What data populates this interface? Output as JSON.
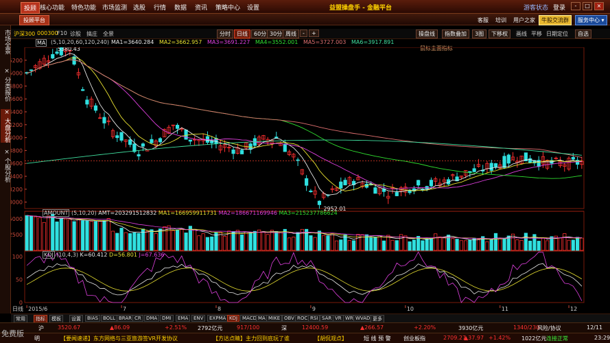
{
  "menubar": {
    "items": [
      {
        "label": "投顾",
        "active": true
      },
      {
        "label": "核心功能"
      },
      {
        "label": "特色功能"
      },
      {
        "label": "市场监测"
      },
      {
        "label": "选股"
      },
      {
        "label": "行情"
      },
      {
        "label": "数据"
      },
      {
        "label": "资讯"
      },
      {
        "label": "策略中心"
      },
      {
        "label": "设置"
      }
    ],
    "app_title": "益盟操盘手 - 金融平台",
    "user_status": "游客状态",
    "login": "登录",
    "window_buttons": [
      "-",
      "□",
      "×"
    ]
  },
  "bar2": {
    "platform": "投顾平台",
    "links": [
      "客服",
      "培训",
      "用户之家"
    ],
    "promo": "牛股交流群",
    "service": "服务中心 ▾"
  },
  "left_tabs": [
    "市场全景",
    "× 分类报价",
    "× 大盘分析",
    "× 个股分析"
  ],
  "toolbar": {
    "symbol": "沪深300",
    "code": "000300",
    "items": [
      "F10",
      "诊股",
      "搞庄",
      "全景"
    ],
    "periods": [
      "分时",
      "日线",
      "60分",
      "30分",
      "周线"
    ],
    "active_period": "日线",
    "right": [
      "操盘线",
      "指数叠加",
      "3图",
      "下移权",
      "画线",
      "平移",
      "日期定位",
      "自选"
    ]
  },
  "main_panel": {
    "ma_label": "MA",
    "params": "(5,10,20,60,120,240)",
    "ma1": "MA1=3640.284",
    "ma2": "MA2=3662.957",
    "ma3": "MA3=3691.227",
    "ma4": "MA4=3552.001",
    "ma5": "MA5=3727.003",
    "ma6": "MA6=3917.891",
    "hint": "鼠标圭面指标",
    "high_label": "5380.43",
    "low_label": "2952.01",
    "y_ticks": [
      "5200",
      "5000",
      "4800",
      "4600",
      "4400",
      "4200",
      "4000",
      "3800",
      "3600",
      "3400",
      "3200",
      "3000"
    ],
    "colors": {
      "up": "#ff3030",
      "down": "#30e0e0",
      "ma5": "#e8e8e8",
      "ma10": "#e8e030",
      "ma20": "#e040e0",
      "ma60": "#30e030",
      "ma120": "#e07070",
      "ma240": "#40e0a0"
    }
  },
  "volume_panel": {
    "label": "AMOUNT",
    "params": "(5,10,20)",
    "amt": "AMT=203291512832",
    "ma1": "MA1=166959911731",
    "ma2": "MA2=186671169946",
    "ma3": "MA3=215237786624",
    "y_ticks": [
      "5000",
      "2500"
    ]
  },
  "kdj_panel": {
    "label": "KDJ",
    "params": "(10,4,3)",
    "k": "K=60.412",
    "d": "D=56.801",
    "j": "J=67.636",
    "y_ticks": [
      "100",
      "50",
      "0"
    ]
  },
  "x_axis": {
    "period_label": "日线",
    "labels": [
      "2015/6",
      "7",
      "8",
      "9",
      "10",
      "11",
      "12"
    ]
  },
  "bottom_tabs": [
    "常用",
    "指标",
    "模板",
    "设置",
    "BIAS",
    "BOLL",
    "BRAR",
    "CR",
    "DMA",
    "DMI",
    "EMA",
    "ENV",
    "EXPMA",
    "KDJ",
    "MACD",
    "MA",
    "MIKE",
    "OBV",
    "ROC",
    "RSI",
    "SAR",
    "VR",
    "WR",
    "WVAD",
    "更多"
  ],
  "ticker1": {
    "items": [
      {
        "t": "沪",
        "c": "white"
      },
      {
        "t": "3520.67",
        "c": "red"
      },
      {
        "t": "▲86.09",
        "c": "red"
      },
      {
        "t": "+2.51%",
        "c": "red"
      },
      {
        "t": "2792亿元",
        "c": "white"
      },
      {
        "t": "917/100",
        "c": "red"
      },
      {
        "t": "深",
        "c": "white"
      },
      {
        "t": "12400.59",
        "c": "red"
      },
      {
        "t": "▲266.57",
        "c": "red"
      },
      {
        "t": "+2.20%",
        "c": "red"
      },
      {
        "t": "3930亿元",
        "c": "white"
      },
      {
        "t": "1340/230",
        "c": "red"
      },
      {
        "t": "风险/协议",
        "c": "white"
      },
      {
        "t": "12/11",
        "c": "white"
      }
    ]
  },
  "ticker2": {
    "free": "免费版",
    "items": [
      {
        "t": "明",
        "c": "white"
      },
      {
        "t": "【要闻速递】东方网络与三亚旅游签VR开发协议",
        "c": "yellow"
      },
      {
        "t": "【方达点睛】主力回到底玩了谁",
        "c": "yellow"
      },
      {
        "t": "【胡侃观点】",
        "c": "yellow"
      },
      {
        "t": "短 线 预 警",
        "c": "white"
      },
      {
        "t": "创业板指",
        "c": "white"
      },
      {
        "t": "2709.27",
        "c": "red"
      },
      {
        "t": "▲37.97",
        "c": "red"
      },
      {
        "t": "+1.42%",
        "c": "red"
      },
      {
        "t": "1022亿元",
        "c": "white"
      },
      {
        "t": "连接正常",
        "c": "green"
      },
      {
        "t": "23:29",
        "c": "white"
      }
    ]
  }
}
